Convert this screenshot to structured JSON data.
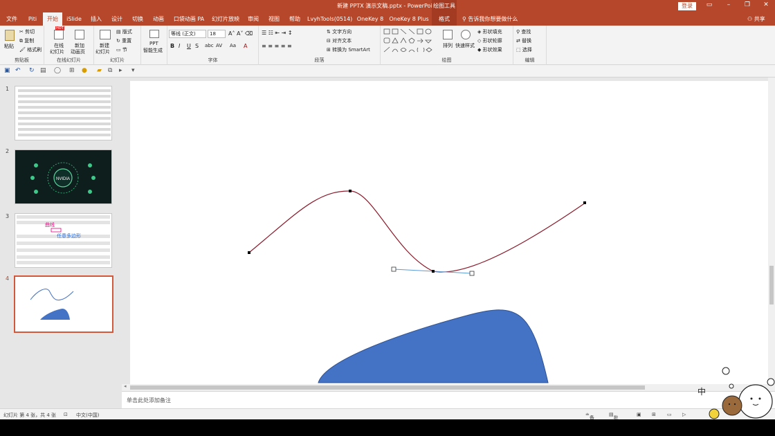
{
  "window": {
    "title": "新建 PPTX 演示文稿.pptx  -  PowerPoint",
    "context_tab_group": "绘图工具",
    "login_label": "登录"
  },
  "tabs": [
    "文件",
    "Piti",
    "开始",
    "iSlide",
    "插入",
    "设计",
    "切换",
    "动画",
    "口袋动画 PA",
    "幻灯片放映",
    "审阅",
    "视图",
    "帮助",
    "LvyhTools(0514)",
    "OneKey 8",
    "OneKey 8 Plus",
    "格式"
  ],
  "tell_me": "告诉我你想要做什么",
  "share_label": "共享",
  "ribbon": {
    "clipboard": {
      "label": "剪贴板",
      "paste": "粘贴",
      "cut": "剪切",
      "copy": "复制",
      "format_painter": "格式刷"
    },
    "online_slides": {
      "label": "在线幻灯片",
      "online": "在线",
      "online2": "幻灯片",
      "new_anim": "新加",
      "new_anim2": "动画页",
      "hot_badge": "HOT"
    },
    "slides": {
      "label": "幻灯片",
      "new_slide": "新建",
      "new_slide2": "幻灯片",
      "layout": "版式",
      "reset": "重置",
      "section": "节"
    },
    "ppt_smart": {
      "line1": "PPT",
      "line2": "智能生成"
    },
    "font": {
      "label": "字体",
      "font_name": "等线 (正文)",
      "font_size": "18"
    },
    "paragraph": {
      "label": "段落",
      "text_direction": "文字方向",
      "align_text": "对齐文本",
      "smartart": "转换为 SmartArt"
    },
    "drawing": {
      "label": "绘图",
      "arrange": "排列",
      "quick_styles": "快速样式",
      "fill": "形状填充",
      "outline": "形状轮廓",
      "effects": "形状效果"
    },
    "editing": {
      "label": "编辑",
      "find": "查找",
      "replace": "替换",
      "select": "选择"
    }
  },
  "slides": [
    {
      "number": "1"
    },
    {
      "number": "2",
      "thumb_text": "NVIDIA"
    },
    {
      "number": "3",
      "label_a": "曲线",
      "label_b": "任意多边形"
    },
    {
      "number": "4"
    }
  ],
  "notes_placeholder": "单击此处添加备注",
  "status": {
    "slide_info": "幻灯片 第 4 张，共 4 张",
    "language": "中文(中国)",
    "notes_btn": "备注",
    "comments_btn": "批注"
  },
  "colors": {
    "accent": "#b7472a",
    "curve": "#8b1a2b",
    "shape_fill": "#4472c4",
    "handle_line": "#5b9bd5"
  }
}
